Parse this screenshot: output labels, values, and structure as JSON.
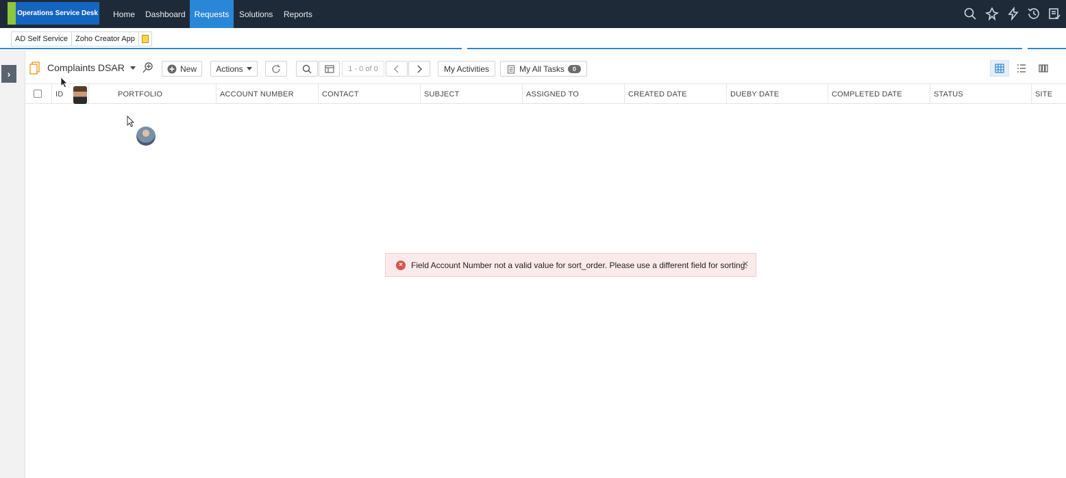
{
  "app": {
    "brand": "Operations Service Desk",
    "colors": {
      "nav_bg": "#1f2a38",
      "accent": "#2a86d6",
      "brand_green": "#8dc63f",
      "error": "#d9534f"
    }
  },
  "nav": {
    "items": [
      {
        "label": "Home"
      },
      {
        "label": "Dashboard"
      },
      {
        "label": "Requests",
        "active": true
      },
      {
        "label": "Solutions"
      },
      {
        "label": "Reports"
      }
    ],
    "icons": [
      "search-icon",
      "rocket-icon",
      "lightning-icon",
      "history-icon",
      "tasks-icon"
    ]
  },
  "quicklinks": {
    "items": [
      {
        "label": "AD Self Service"
      },
      {
        "label": "Zoho Creator App"
      }
    ]
  },
  "toolbar": {
    "view_name": "Complaints DSAR",
    "new_label": "New",
    "actions_label": "Actions",
    "pager_text": "1 - 0 of 0",
    "my_activities_label": "My Activities",
    "my_all_tasks_label": "My All Tasks",
    "my_all_tasks_count": "0"
  },
  "table": {
    "columns": [
      "ID",
      "PORTFOLIO",
      "ACCOUNT NUMBER",
      "CONTACT",
      "SUBJECT",
      "ASSIGNED TO",
      "CREATED DATE",
      "DUEBY DATE",
      "COMPLETED DATE",
      "STATUS",
      "SITE"
    ],
    "rows": []
  },
  "toast": {
    "type": "error",
    "message": "Field Account Number not a valid value for sort_order. Please use a different field for sorting."
  }
}
